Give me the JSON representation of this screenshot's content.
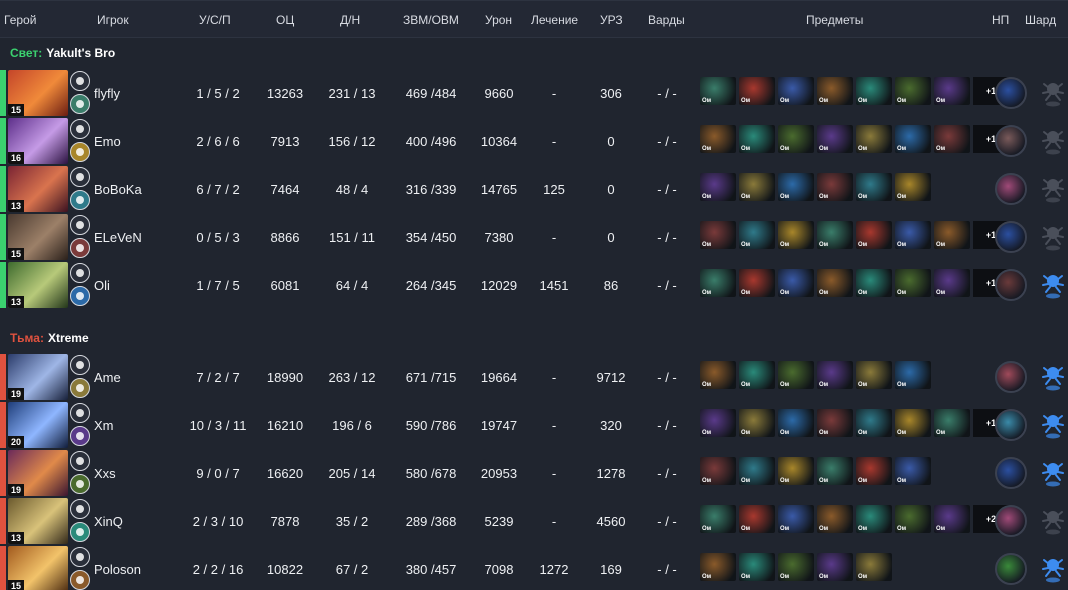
{
  "columns": {
    "hero": "Герой",
    "player": "Игрок",
    "kda": "У/С/П",
    "networth": "ОЦ",
    "lh_dn": "Д/Н",
    "gpm_xpm": "ЗВМ/ОВМ",
    "damage": "Урон",
    "heal": "Лечение",
    "building": "УРЗ",
    "wards": "Варды",
    "items": "Предметы",
    "np": "НП",
    "shard": "Шард"
  },
  "radiant": {
    "side_label": "Свет:",
    "team_name": "Yakult's Bro",
    "color": "#3bd16f",
    "players": [
      {
        "level": "15",
        "name": "flyfly",
        "kda": "1 / 5 / 2",
        "networth": "13263",
        "lh_dn": "231 / 13",
        "gpm_xpm": "469 /484",
        "damage": "9660",
        "heal": "-",
        "building": "306",
        "wards": "- / -",
        "extra_items": "+1",
        "shard_active": false
      },
      {
        "level": "16",
        "name": "Emo",
        "kda": "2 / 6 / 6",
        "networth": "7913",
        "lh_dn": "156 / 12",
        "gpm_xpm": "400 /496",
        "damage": "10364",
        "heal": "-",
        "building": "0",
        "wards": "- / -",
        "extra_items": "+1",
        "shard_active": false
      },
      {
        "level": "13",
        "name": "BoBoKa",
        "kda": "6 / 7 / 2",
        "networth": "7464",
        "lh_dn": "48 / 4",
        "gpm_xpm": "316 /339",
        "damage": "14765",
        "heal": "125",
        "building": "0",
        "wards": "- / -",
        "extra_items": "",
        "shard_active": false
      },
      {
        "level": "15",
        "name": "ELeVeN",
        "kda": "0 / 5 / 3",
        "networth": "8866",
        "lh_dn": "151 / 11",
        "gpm_xpm": "354 /450",
        "damage": "7380",
        "heal": "-",
        "building": "0",
        "wards": "- / -",
        "extra_items": "+1",
        "shard_active": false
      },
      {
        "level": "13",
        "name": "Oli",
        "kda": "1 / 7 / 5",
        "networth": "6081",
        "lh_dn": "64 / 4",
        "gpm_xpm": "264 /345",
        "damage": "12029",
        "heal": "1451",
        "building": "86",
        "wards": "- / -",
        "extra_items": "+1",
        "shard_active": true
      }
    ]
  },
  "dire": {
    "side_label": "Тьма:",
    "team_name": "Xtreme",
    "color": "#e0523f",
    "players": [
      {
        "level": "19",
        "name": "Ame",
        "kda": "7 / 2 / 7",
        "networth": "18990",
        "lh_dn": "263 / 12",
        "gpm_xpm": "671 /715",
        "damage": "19664",
        "heal": "-",
        "building": "9712",
        "wards": "- / -",
        "extra_items": "",
        "shard_active": true
      },
      {
        "level": "20",
        "name": "Xm",
        "kda": "10 / 3 / 11",
        "networth": "16210",
        "lh_dn": "196 / 6",
        "gpm_xpm": "590 /786",
        "damage": "19747",
        "heal": "-",
        "building": "320",
        "wards": "- / -",
        "extra_items": "+1",
        "shard_active": true
      },
      {
        "level": "19",
        "name": "Xxs",
        "kda": "9 / 0 / 7",
        "networth": "16620",
        "lh_dn": "205 / 14",
        "gpm_xpm": "580 /678",
        "damage": "20953",
        "heal": "-",
        "building": "1278",
        "wards": "- / -",
        "extra_items": "",
        "shard_active": true
      },
      {
        "level": "13",
        "name": "XinQ",
        "kda": "2 / 3 / 10",
        "networth": "7878",
        "lh_dn": "35 / 2",
        "gpm_xpm": "289 /368",
        "damage": "5239",
        "heal": "-",
        "building": "4560",
        "wards": "- / -",
        "extra_items": "+2",
        "shard_active": false
      },
      {
        "level": "15",
        "name": "Poloson",
        "kda": "2 / 2 / 16",
        "networth": "10822",
        "lh_dn": "67 / 2",
        "gpm_xpm": "380 /457",
        "damage": "7098",
        "heal": "1272",
        "building": "169",
        "wards": "- / -",
        "extra_items": "",
        "shard_active": true
      }
    ]
  },
  "colors": {
    "background": "#20252f",
    "header": "#232834",
    "shard_active": "#3d8cf0",
    "shard_inactive": "#4a4f5a"
  }
}
